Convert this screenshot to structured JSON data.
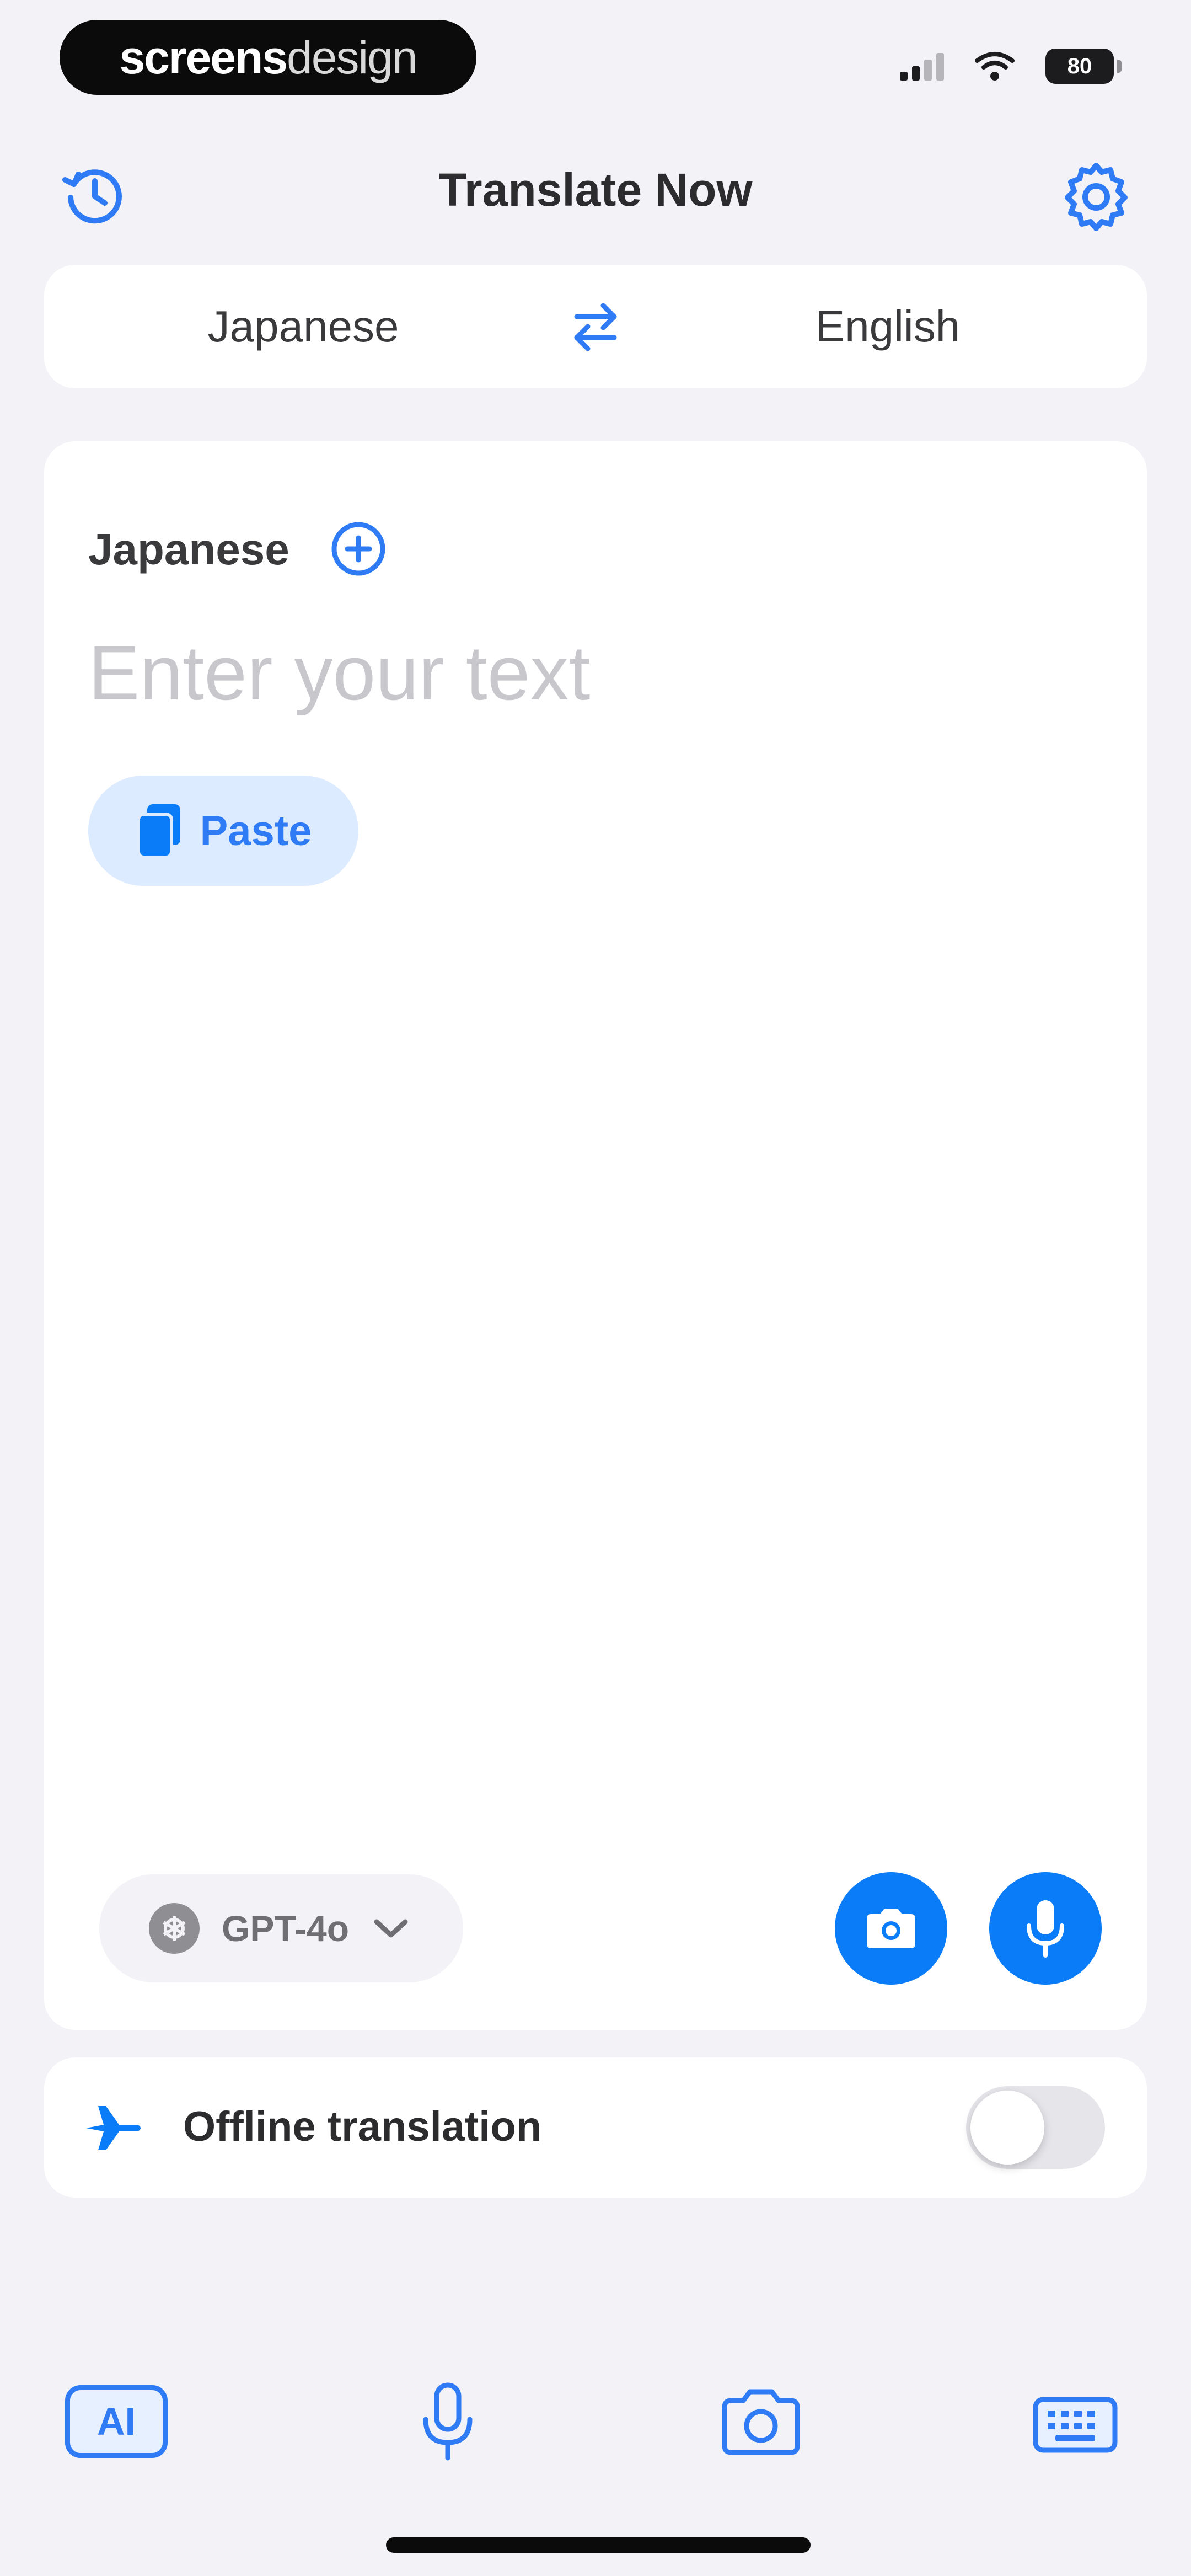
{
  "status_bar": {
    "brand_bold": "screens",
    "brand_light": "design",
    "battery": "80"
  },
  "header": {
    "title": "Translate Now"
  },
  "language_selector": {
    "source": "Japanese",
    "target": "English"
  },
  "input_panel": {
    "source_label": "Japanese",
    "placeholder": "Enter your text",
    "value": "",
    "paste_label": "Paste",
    "model_label": "GPT-4o"
  },
  "offline": {
    "label": "Offline translation",
    "enabled": false
  },
  "tab_bar": {
    "ai_label": "AI"
  },
  "colors": {
    "accent": "#0A7CF8",
    "background": "#F2F2F7",
    "card": "#FFFFFF",
    "paste_bg": "#DCEBFF"
  },
  "icons": {
    "history": "history-clock-icon",
    "settings": "gear-icon",
    "swap": "swap-arrows-icon",
    "add": "plus-circle-icon",
    "paste": "clipboard-icon",
    "model": "openai-logo-icon",
    "camera": "camera-icon",
    "mic": "microphone-icon",
    "offline": "airplane-icon",
    "keyboard": "keyboard-icon"
  }
}
